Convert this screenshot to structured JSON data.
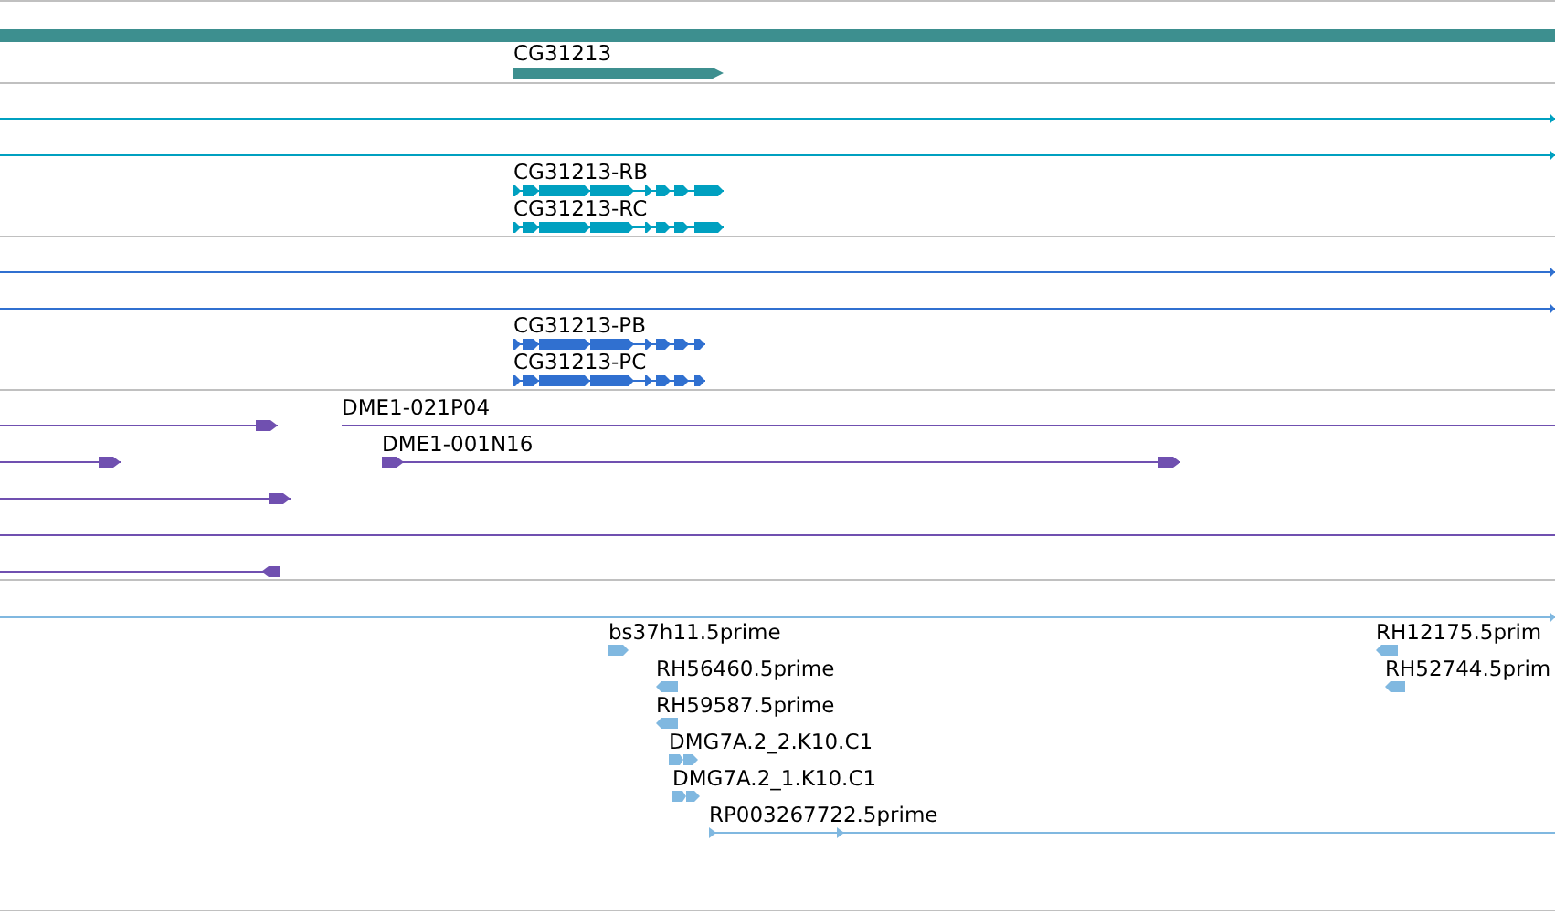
{
  "tracks": [
    {
      "kind": "gene",
      "color": "#3d8f8f",
      "features": [
        {
          "label": "CG31213"
        }
      ]
    },
    {
      "kind": "transcript",
      "color": "#00a0c0",
      "features": [
        {
          "label": "CG31213-RB"
        },
        {
          "label": "CG31213-RC"
        }
      ]
    },
    {
      "kind": "transcript",
      "color": "#3070d0",
      "features": [
        {
          "label": "CG31213-PB"
        },
        {
          "label": "CG31213-PC"
        }
      ]
    },
    {
      "kind": "clone",
      "color": "#7050b0",
      "features": [
        {
          "label": "DME1-021P04"
        },
        {
          "label": "DME1-001N16"
        }
      ]
    },
    {
      "kind": "est",
      "color": "#80b8e0",
      "features": [
        {
          "label": "bs37h11.5prime"
        },
        {
          "label": "RH56460.5prime"
        },
        {
          "label": "RH59587.5prime"
        },
        {
          "label": "DMG7A.2_2.K10.C1"
        },
        {
          "label": "DMG7A.2_1.K10.C1"
        },
        {
          "label": "RP003267722.5prime"
        },
        {
          "label": "RH12175.5prim"
        },
        {
          "label": "RH52744.5prim"
        }
      ]
    }
  ]
}
